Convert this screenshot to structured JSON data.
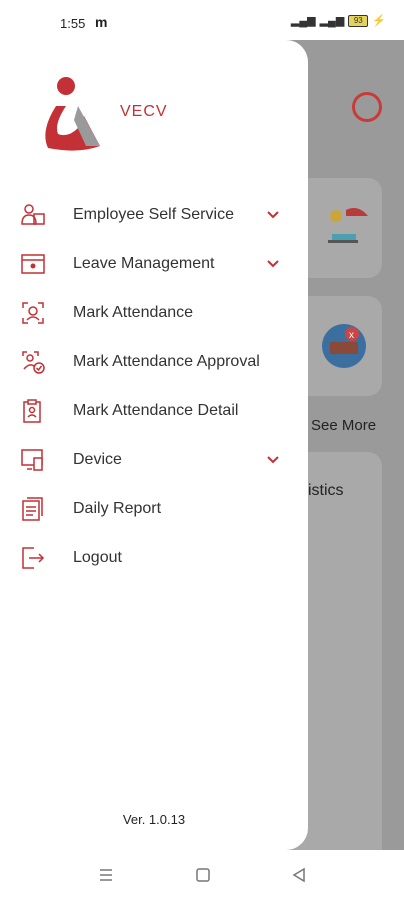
{
  "status_bar": {
    "time": "1:55",
    "app_indicator": "m",
    "battery": "93"
  },
  "brand": {
    "name": "VECV"
  },
  "menu": {
    "items": [
      {
        "label": "Employee Self Service",
        "icon": "employee-icon",
        "has_dropdown": true
      },
      {
        "label": "Leave Management",
        "icon": "calendar-icon",
        "has_dropdown": true
      },
      {
        "label": "Mark Attendance",
        "icon": "face-scan-icon",
        "has_dropdown": false
      },
      {
        "label": "Mark Attendance Approval",
        "icon": "approval-icon",
        "has_dropdown": false
      },
      {
        "label": "Mark Attendance Detail",
        "icon": "clipboard-icon",
        "has_dropdown": false
      },
      {
        "label": "Device",
        "icon": "device-icon",
        "has_dropdown": true
      },
      {
        "label": "Daily Report",
        "icon": "report-icon",
        "has_dropdown": false
      },
      {
        "label": "Logout",
        "icon": "logout-icon",
        "has_dropdown": false
      }
    ]
  },
  "version": "Ver. 1.0.13",
  "background": {
    "see_more": "See More",
    "statistics_partial": "istics"
  },
  "colors": {
    "accent": "#c33136",
    "drawer_bg": "#ffffff",
    "overlay": "#9a9a9a"
  }
}
